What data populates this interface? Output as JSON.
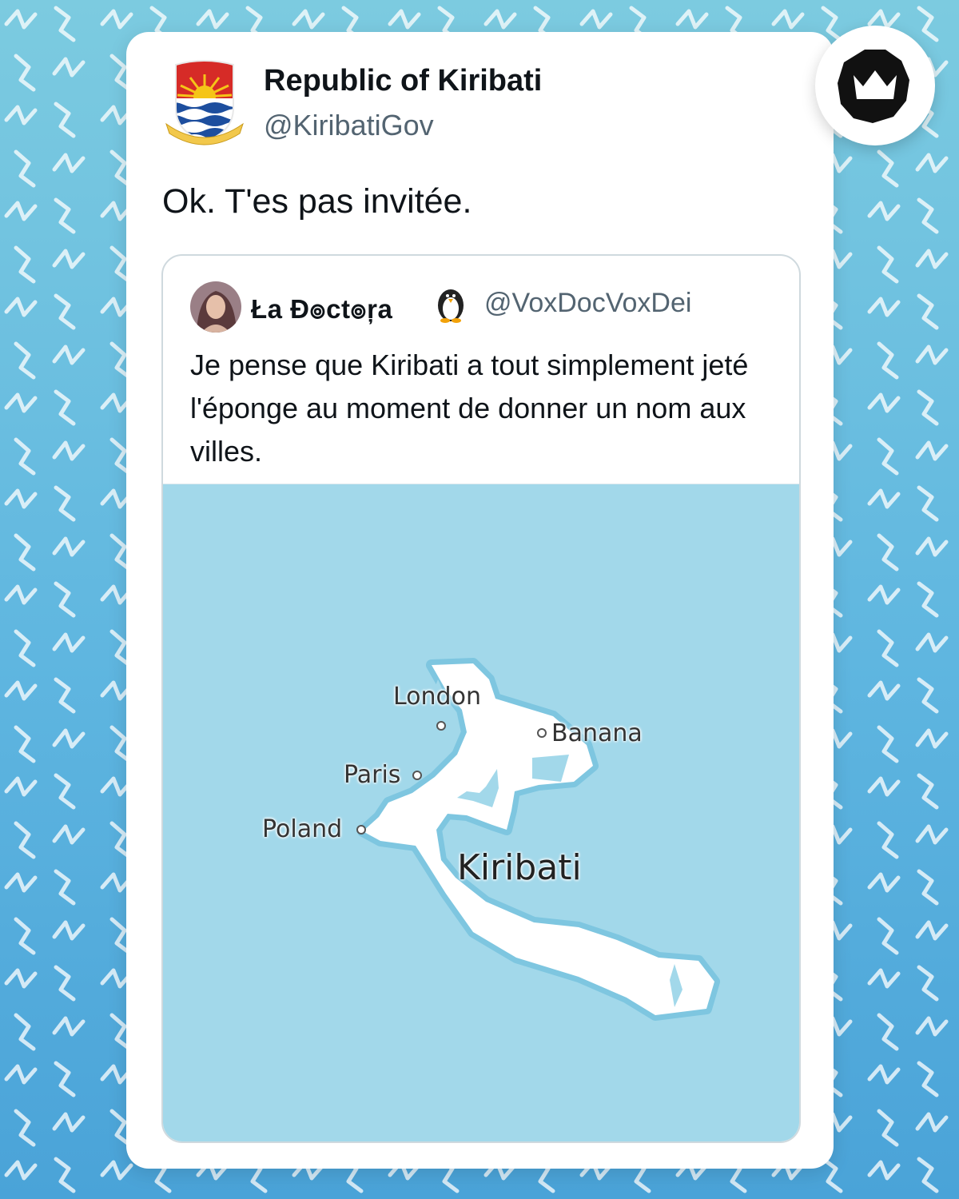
{
  "post": {
    "author_name": "Republic of Kiribati",
    "author_handle": "@KiribatiGov",
    "text": "Ok. T'es pas invitée."
  },
  "quoted_post": {
    "author_name": "Ła Ɖ๏ct๏ŗa",
    "author_handle": "@VoxDocVoxDei",
    "text": "Je pense que Kiribati a tout simplement jeté l'éponge au moment de donner un nom aux villes.",
    "map": {
      "country_label": "Kiribati",
      "places": [
        "London",
        "Banana",
        "Paris",
        "Poland"
      ]
    }
  },
  "icons": {
    "author_avatar": "kiribati-coat-of-arms-icon",
    "site_badge": "crown-icon",
    "quoted_avatar": "user-photo-avatar",
    "emoji": "penguin-icon"
  },
  "colors": {
    "background": "#5fb6e0",
    "card": "#ffffff",
    "map_water": "#a2d8ea",
    "map_land": "#ffffff",
    "badge_octagon": "#111111"
  }
}
